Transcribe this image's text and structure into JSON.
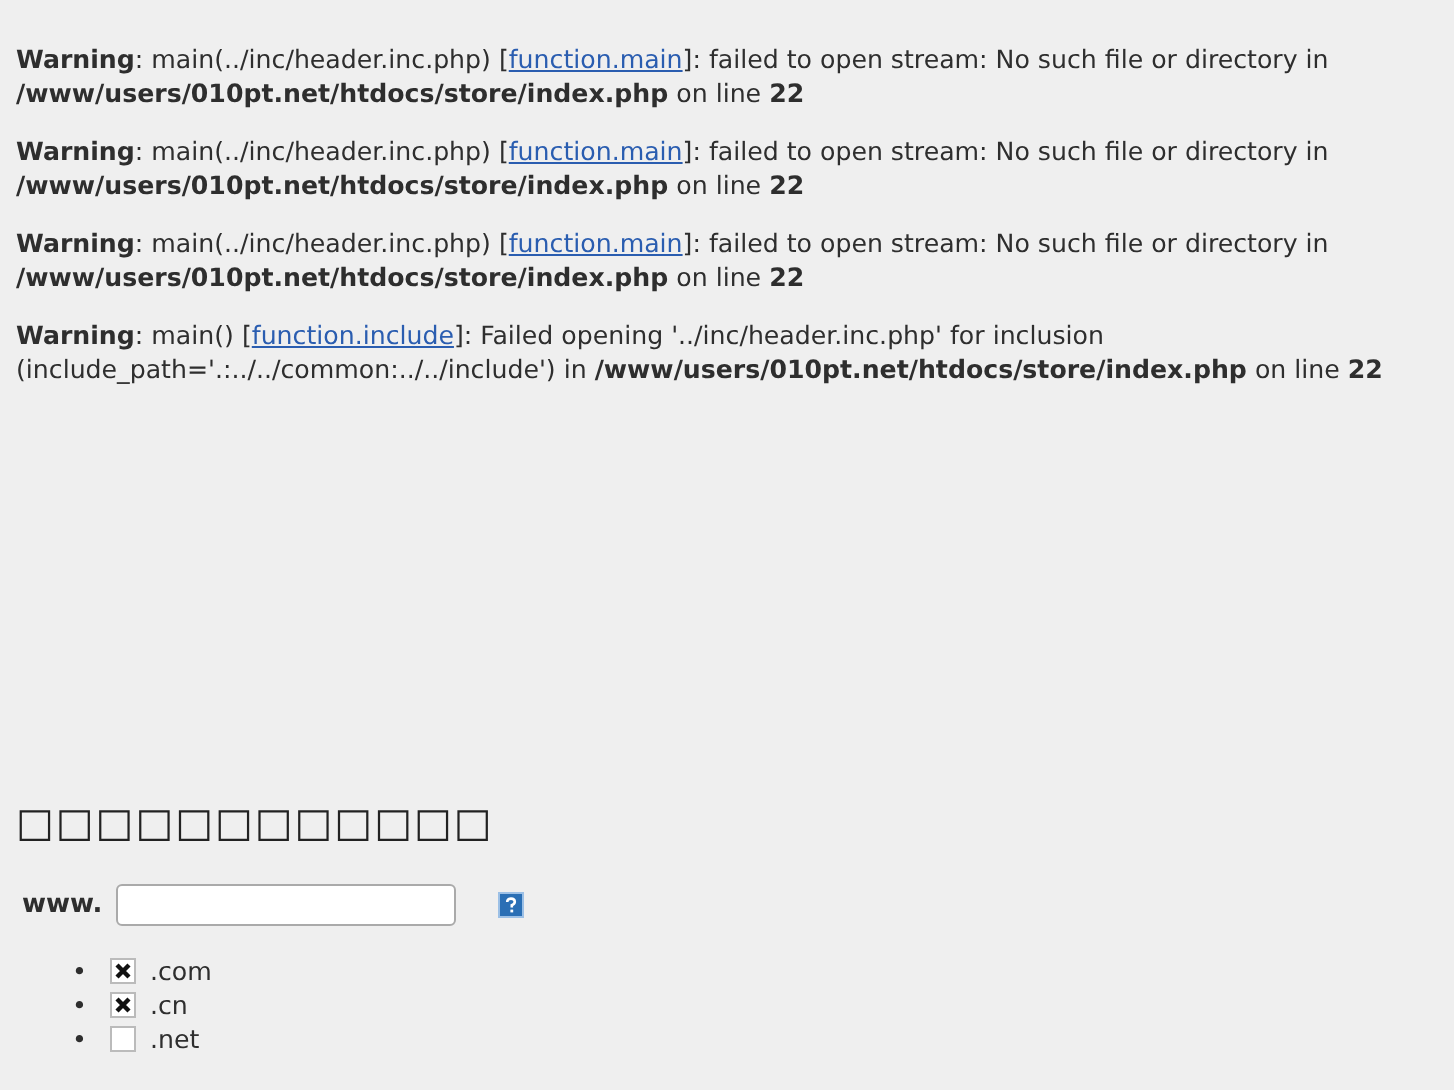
{
  "warnings": [
    {
      "before": "**Warning**: main(../inc/header.inc.php) [",
      "link": "function.main",
      "after": "]: failed to open stream: No such file or directory in **/www/users/010pt.net/htdocs/store/index.php** on line **22**"
    },
    {
      "before": "**Warning**: main(../inc/header.inc.php) [",
      "link": "function.main",
      "after": "]: failed to open stream: No such file or directory in **/www/users/010pt.net/htdocs/store/index.php** on line **22**"
    },
    {
      "before": "**Warning**: main(../inc/header.inc.php) [",
      "link": "function.main",
      "after": "]: failed to open stream: No such file or directory in **/www/users/010pt.net/htdocs/store/index.php** on line **22**"
    },
    {
      "before": "**Warning**: main() [",
      "link": "function.include",
      "after": "]: Failed opening '../inc/header.inc.php' for inclusion (include_path='.:../../common:../../include') in **/www/users/010pt.net/htdocs/store/index.php** on line **22**"
    }
  ],
  "heading": "□□□□□□□□□□□□",
  "domain_form": {
    "prefix": "www."
  },
  "extensions": [
    {
      "bullet": "•",
      "label": ".com",
      "checked": true
    },
    {
      "bullet": "•",
      "label": ".cn",
      "checked": true
    },
    {
      "bullet": "•",
      "label": ".net",
      "checked": false
    }
  ]
}
